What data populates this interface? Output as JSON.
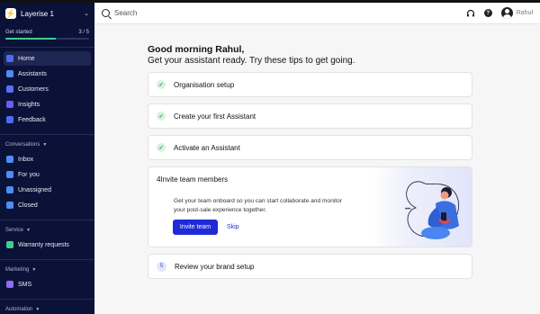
{
  "workspace": {
    "name": "Layerise 1"
  },
  "sidebar": {
    "get_started": {
      "label": "Get started",
      "progress_text": "3 / 5",
      "progress": 0.6
    },
    "main_nav": [
      {
        "label": "Home",
        "icon": "home-icon",
        "color": "#4f6bf5",
        "active": true
      },
      {
        "label": "Assistants",
        "icon": "assistant-icon",
        "color": "#4f8cf5"
      },
      {
        "label": "Customers",
        "icon": "customers-icon",
        "color": "#5b6ef5"
      },
      {
        "label": "Insights",
        "icon": "insights-icon",
        "color": "#6a5cf5"
      },
      {
        "label": "Feedback",
        "icon": "star-icon",
        "color": "#4f6bf5"
      }
    ],
    "conversations": {
      "title": "Conversations",
      "items": [
        {
          "label": "Inbox",
          "icon": "inbox-icon",
          "color": "#4f8cf5"
        },
        {
          "label": "For you",
          "icon": "for-you-icon",
          "color": "#4f8cf5"
        },
        {
          "label": "Unassigned",
          "icon": "unassigned-icon",
          "color": "#4f8cf5"
        },
        {
          "label": "Closed",
          "icon": "closed-icon",
          "color": "#4f8cf5"
        }
      ]
    },
    "service": {
      "title": "Service",
      "items": [
        {
          "label": "Warranty requests",
          "icon": "warranty-icon",
          "color": "#3ecf8e"
        }
      ]
    },
    "marketing": {
      "title": "Marketing",
      "items": [
        {
          "label": "SMS",
          "icon": "sms-icon",
          "color": "#8e6cf5"
        }
      ]
    },
    "automation": {
      "title": "Automation"
    }
  },
  "topbar": {
    "search_placeholder": "Search",
    "user_name": "Rahul"
  },
  "main": {
    "greeting": "Good morning Rahul,",
    "subtitle": "Get your assistant ready. Try these tips to get going.",
    "steps": [
      {
        "label": "Organisation setup",
        "done": true
      },
      {
        "label": "Create your first Assistant",
        "done": true
      },
      {
        "label": "Activate an Assistant",
        "done": true
      }
    ],
    "invite": {
      "number": "4",
      "title": "Invite team members",
      "description": "Get your team onboard so you can start collaborate and monitor your post-sale experience together.",
      "primary_button": "Invite team",
      "secondary_button": "Skip"
    },
    "review": {
      "number": "5",
      "label": "Review your brand setup"
    }
  }
}
